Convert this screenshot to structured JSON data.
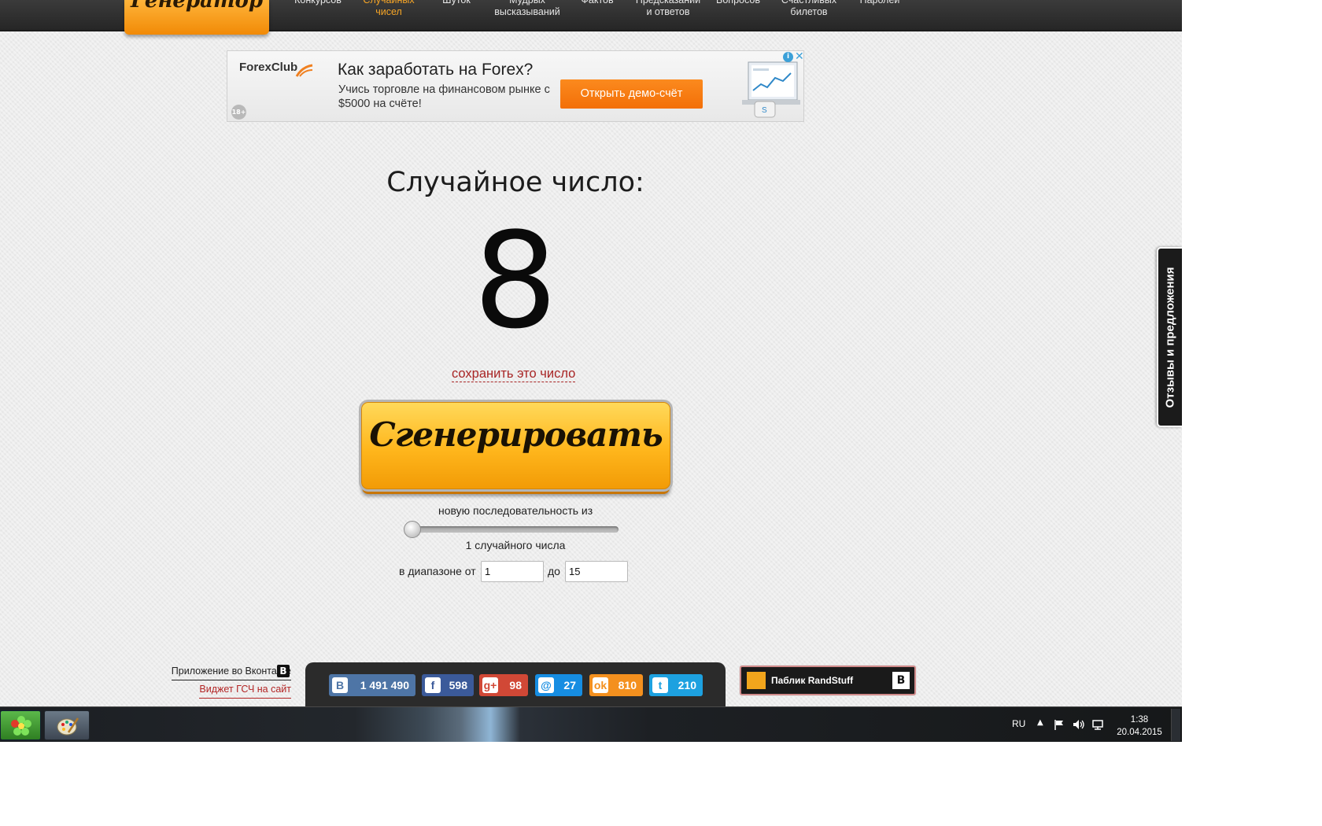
{
  "logo": {
    "text": "Генератор"
  },
  "nav": [
    {
      "l1": "",
      "l2": "Конкурсов",
      "active": false
    },
    {
      "l1": "Случайных",
      "l2": "чисел",
      "active": true
    },
    {
      "l1": "",
      "l2": "Шуток",
      "active": false
    },
    {
      "l1": "Мудрых",
      "l2": "высказываний",
      "active": false
    },
    {
      "l1": "",
      "l2": "Фактов",
      "active": false
    },
    {
      "l1": "Предсказаний",
      "l2": "и ответов",
      "active": false
    },
    {
      "l1": "",
      "l2": "Вопросов",
      "active": false
    },
    {
      "l1": "Счастливых",
      "l2": "билетов",
      "active": false
    },
    {
      "l1": "",
      "l2": "Паролей",
      "active": false
    }
  ],
  "ad": {
    "brand": "ForexClub",
    "title": "Как заработать на Forex?",
    "text": "Учись торговле на финансовом рынке с $5000 на счёте!",
    "button": "Открыть демо-счёт",
    "age": "18+",
    "close": "✕",
    "info": "i"
  },
  "generator": {
    "title": "Случайное число:",
    "number": "8",
    "save_link": "сохранить это число",
    "button": "Сгенерировать",
    "sequence_label": "новую последовательность из",
    "slider_value": 1,
    "count_label": "1 случайного числа",
    "range_from_label": "в диапазоне от",
    "range_from": "1",
    "range_to_label": "до",
    "range_to": "15"
  },
  "feedback": {
    "label": "Отзывы и предложения"
  },
  "footer": {
    "vk_app": "Приложение во Вконтакте",
    "vk_icon": "B",
    "widget": "Виджет ГСЧ на сайт",
    "shares": [
      {
        "network": "vk",
        "icon": "B",
        "count": "1 491 490",
        "color": "#4e75a6"
      },
      {
        "network": "facebook",
        "icon": "f",
        "count": "598",
        "color": "#3b5a9a"
      },
      {
        "network": "google-plus",
        "icon": "g+",
        "count": "98",
        "color": "#d14836"
      },
      {
        "network": "mailru",
        "icon": "@",
        "count": "27",
        "color": "#168de2"
      },
      {
        "network": "odnoklassniki",
        "icon": "ok",
        "count": "810",
        "color": "#f4901e"
      },
      {
        "network": "twitter",
        "icon": "t",
        "count": "210",
        "color": "#1da1e0"
      }
    ],
    "public": "Паблик RandStuff",
    "public_vk": "B"
  },
  "taskbar": {
    "lang": "RU",
    "time": "1:38",
    "date": "20.04.2015"
  },
  "colors": {
    "accent_orange": "#f6a526",
    "link_red": "#a82525",
    "nav_bg": "#2b2b2b"
  }
}
